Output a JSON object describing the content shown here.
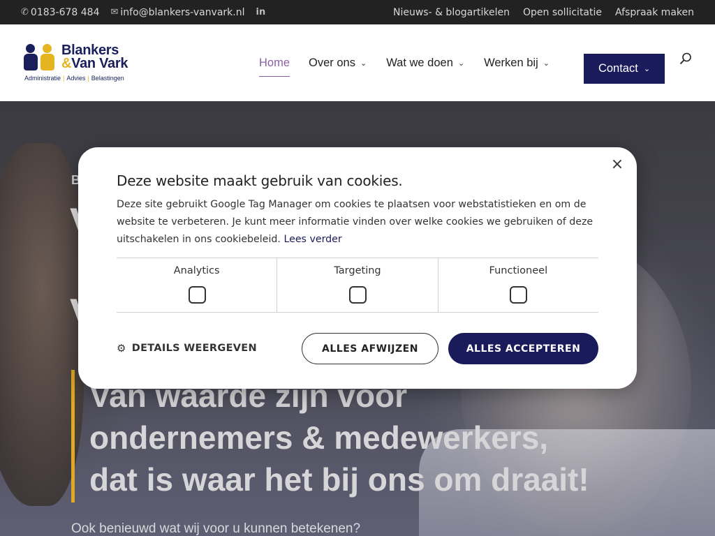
{
  "topbar": {
    "phone": "0183-678 484",
    "phone_icon": "phone-icon",
    "email": "info@blankers-vanvark.nl",
    "email_icon": "envelope-icon",
    "linkedin_icon": "linkedin-icon",
    "linkedin_glyph": "in",
    "links": [
      "Nieuws- & blogartikelen",
      "Open sollicitatie",
      "Afspraak maken"
    ]
  },
  "logo": {
    "line1": "Blankers",
    "amp": "&",
    "line2": "Van Vark",
    "tagline": [
      "Administratie",
      "Advies",
      "Belastingen"
    ],
    "colors": {
      "primary": "#1a1f5c",
      "accent": "#e5b421"
    }
  },
  "nav": {
    "items": [
      {
        "label": "Home",
        "active": true,
        "has_dropdown": false
      },
      {
        "label": "Over ons",
        "active": false,
        "has_dropdown": true
      },
      {
        "label": "Wat we doen",
        "active": false,
        "has_dropdown": true
      },
      {
        "label": "Werken bij",
        "active": false,
        "has_dropdown": true
      }
    ],
    "contact_label": "Contact",
    "active_color": "#8a5ea6",
    "contact_bg": "#1a1b5a",
    "search_icon": "search-icon"
  },
  "hero": {
    "small_label": "B",
    "bg_letter_1": "V",
    "bg_letter_2": "V",
    "headline_line1": "Van waarde zijn voor",
    "headline_line2": "ondernemers & medewerkers,",
    "headline_line3": "dat is waar het bij ons om draait!",
    "subline": "Ook benieuwd wat wij voor u kunnen betekenen?",
    "accent_color": "#e0a823"
  },
  "cookie": {
    "title": "Deze website maakt gebruik van cookies.",
    "body": "Deze site gebruikt Google Tag Manager om cookies te plaatsen voor webstatistieken en om de website te verbeteren. Je kunt meer informatie vinden over welke cookies we gebruiken of deze uitschakelen in ons cookiebeleid.",
    "more_link": "Lees verder",
    "categories": [
      {
        "label": "Analytics",
        "checked": false
      },
      {
        "label": "Targeting",
        "checked": false
      },
      {
        "label": "Functioneel",
        "checked": false
      }
    ],
    "details_label": "DETAILS WEERGEVEN",
    "reject_label": "ALLES AFWIJZEN",
    "accept_label": "ALLES ACCEPTEREN",
    "close_glyph": "×"
  }
}
